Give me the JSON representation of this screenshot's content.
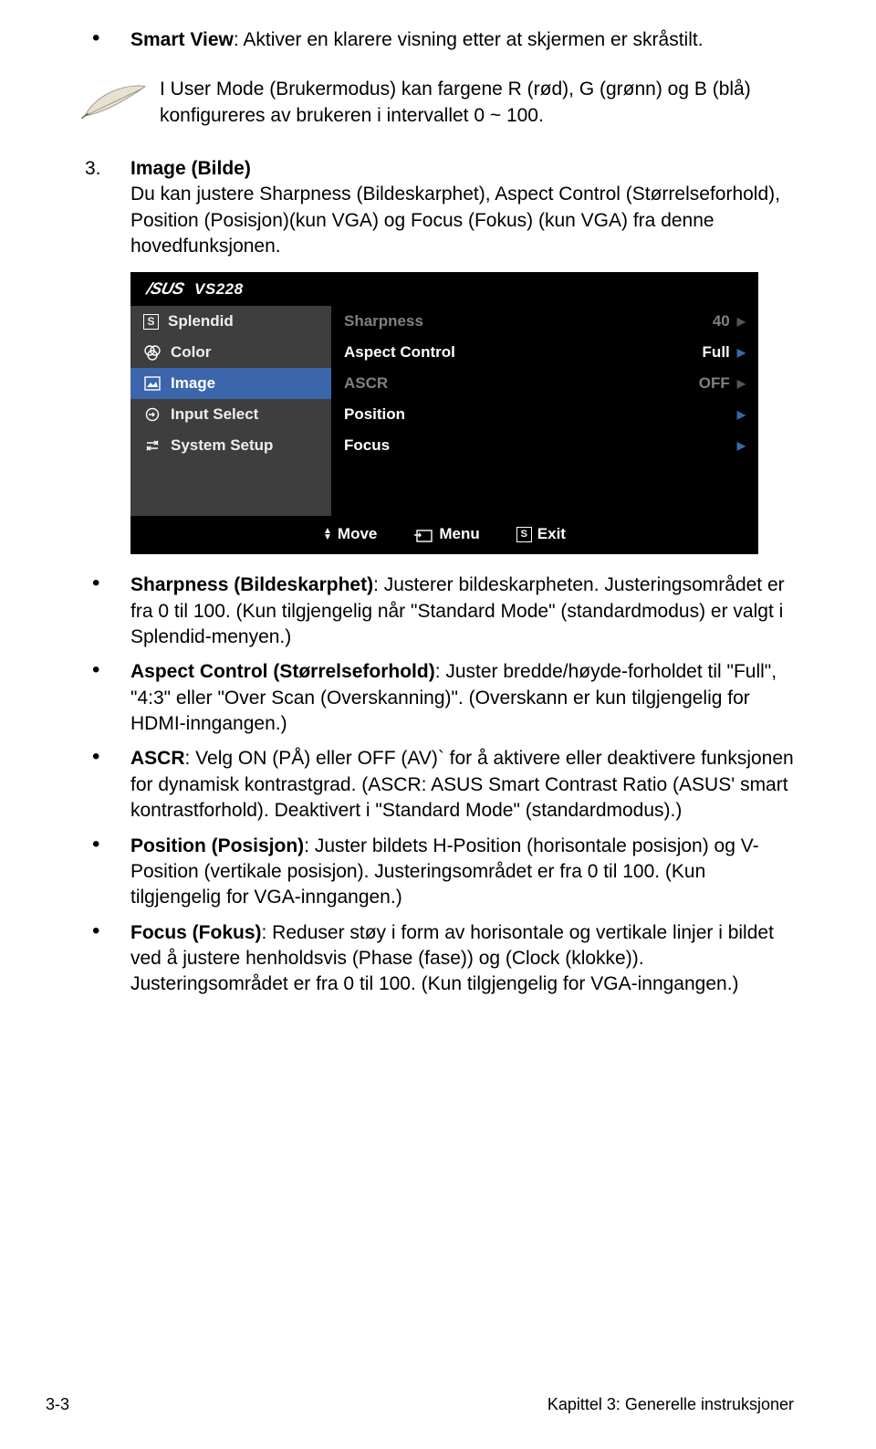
{
  "topBullet": {
    "lead": "Smart View",
    "text": ": Aktiver en klarere visning etter at skjermen er skråstilt."
  },
  "note": {
    "text": "I User Mode (Brukermodus) kan fargene R (rød), G (grønn) og B (blå) konfigureres av brukeren i intervallet 0 ~ 100."
  },
  "item3": {
    "num": "3.",
    "lead": "Image (Bilde)",
    "text": "Du kan justere Sharpness (Bildeskarphet), Aspect Control (Størrelseforhold), Position (Posisjon)(kun VGA) og Focus (Fokus) (kun VGA) fra denne hovedfunksjonen."
  },
  "osd": {
    "brand": "/SUS",
    "model": "VS228",
    "left": [
      {
        "icon": "S",
        "label": "Splendid"
      },
      {
        "icon": "color",
        "label": "Color"
      },
      {
        "icon": "image",
        "label": "Image"
      },
      {
        "icon": "input",
        "label": "Input Select"
      },
      {
        "icon": "setup",
        "label": "System Setup"
      }
    ],
    "right": [
      {
        "label": "Sharpness",
        "value": "40",
        "dim": true
      },
      {
        "label": "Aspect Control",
        "value": "Full",
        "dim": false
      },
      {
        "label": "ASCR",
        "value": "OFF",
        "dim": true
      },
      {
        "label": "Position",
        "value": "",
        "dim": false
      },
      {
        "label": "Focus",
        "value": "",
        "dim": false
      }
    ],
    "footer": {
      "move": "Move",
      "menu": "Menu",
      "exit": "Exit"
    }
  },
  "subs": [
    {
      "lead": "Sharpness (Bildeskarphet)",
      "text": ": Justerer bildeskarpheten. Justeringsområdet er fra 0 til 100. (Kun tilgjengelig når \"Standard Mode\" (standardmodus) er valgt i Splendid-menyen.)"
    },
    {
      "lead": "Aspect Control (Størrelseforhold)",
      "text": ": Juster bredde/høyde-forholdet til \"Full\", \"4:3\" eller \"Over Scan (Overskanning)\". (Overskann er kun tilgjengelig for HDMI-inngangen.)"
    },
    {
      "lead": "ASCR",
      "text": ": Velg ON (PÅ) eller OFF (AV)` for å aktivere eller deaktivere funksjonen for dynamisk kontrastgrad. (ASCR: ASUS Smart Contrast Ratio (ASUS' smart kontrastforhold). Deaktivert i \"Standard Mode\" (standardmodus).)"
    },
    {
      "lead": "Position (Posisjon)",
      "text": ": Juster bildets H-Position (horisontale posisjon) og V-Position (vertikale posisjon). Justeringsområdet er fra 0 til 100. (Kun tilgjengelig for VGA-inngangen.)"
    },
    {
      "lead": "Focus (Fokus)",
      "text": ": Reduser støy i form av horisontale og vertikale linjer i bildet ved å justere henholdsvis (Phase (fase)) og (Clock (klokke)). Justeringsområdet er fra 0 til 100. (Kun tilgjengelig for VGA-inngangen.)"
    }
  ],
  "footer": {
    "left": "3-3",
    "right": "Kapittel 3: Generelle instruksjoner"
  }
}
